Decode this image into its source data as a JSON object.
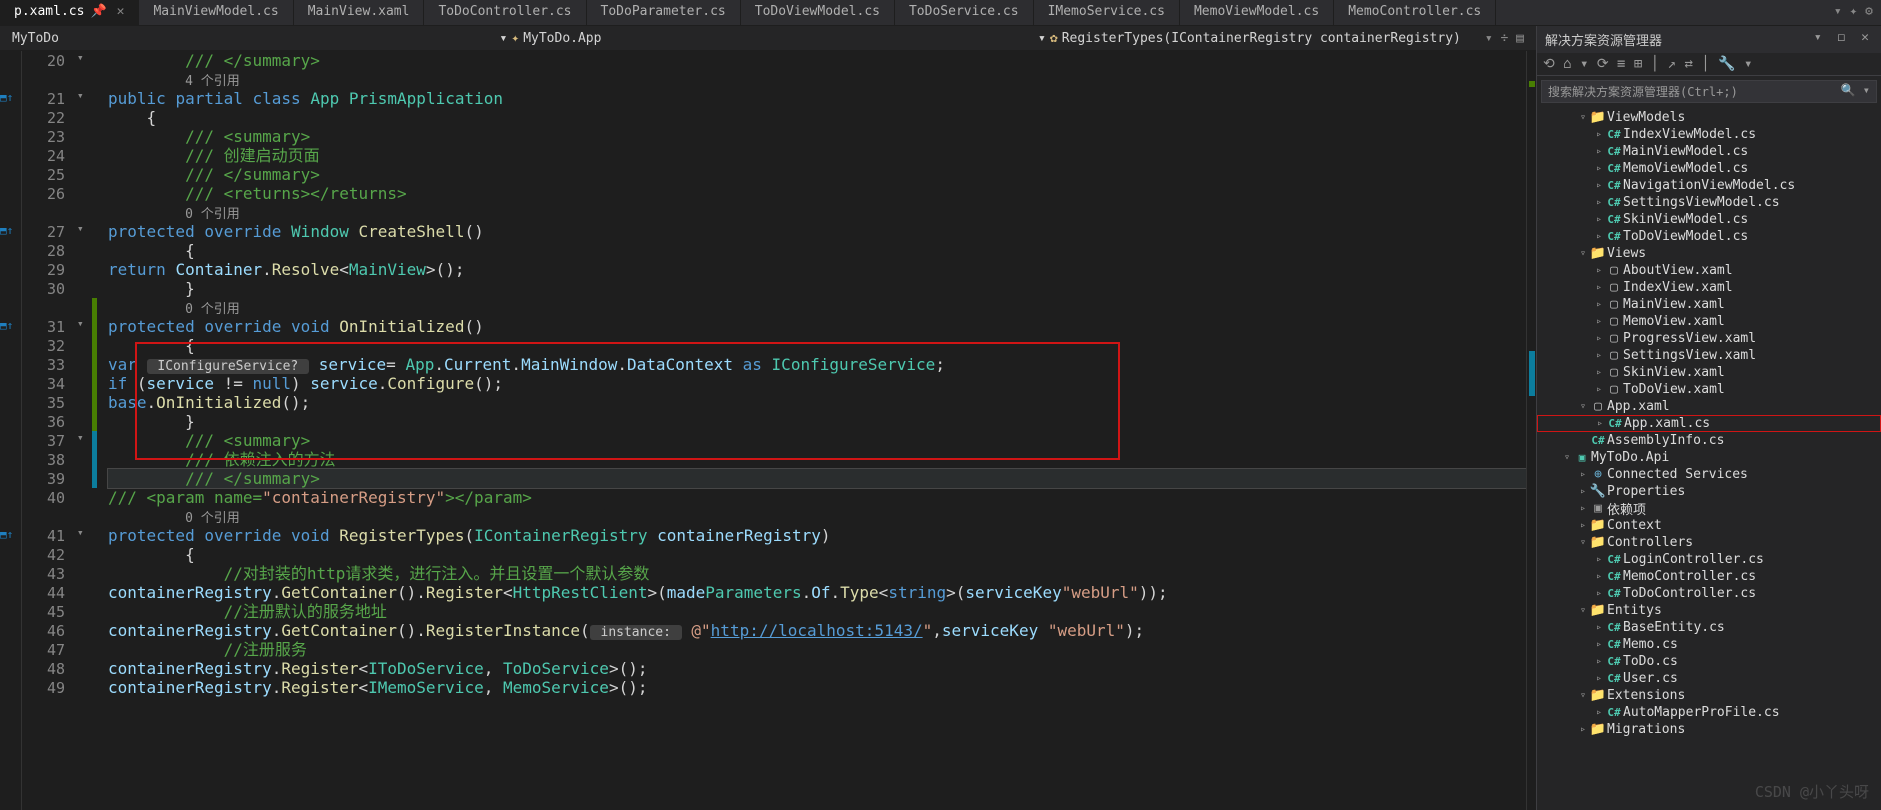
{
  "tabs": [
    {
      "label": "p.xaml.cs",
      "active": true,
      "pinned": true
    },
    {
      "label": "MainViewModel.cs"
    },
    {
      "label": "MainView.xaml"
    },
    {
      "label": "ToDoController.cs"
    },
    {
      "label": "ToDoParameter.cs"
    },
    {
      "label": "ToDoViewModel.cs"
    },
    {
      "label": "ToDoService.cs"
    },
    {
      "label": "IMemoService.cs"
    },
    {
      "label": "MemoViewModel.cs"
    },
    {
      "label": "MemoController.cs"
    }
  ],
  "context": {
    "project": "MyToDo",
    "namespace": "MyToDo.App",
    "method": "RegisterTypes(IContainerRegistry containerRegistry)"
  },
  "gutter_start": 20,
  "code_lines": [
    {
      "n": 20,
      "t": "        /// </summary>",
      "cls": "cmt",
      "fold": "▾"
    },
    {
      "n": "",
      "t": "        4 个引用",
      "cls": "ref"
    },
    {
      "n": 21,
      "t": "    public partial class App : PrismApplication",
      "tok": [
        "kw:public",
        " ",
        "kw:partial",
        " ",
        "kw:class",
        " ",
        "type:App",
        " : ",
        "type:PrismApplication"
      ],
      "fold": "▾",
      "gi": true
    },
    {
      "n": 22,
      "t": "    {"
    },
    {
      "n": 23,
      "t": "        /// <summary>",
      "cls": "cmt"
    },
    {
      "n": 24,
      "t": "        /// 创建启动页面",
      "cls": "cmt"
    },
    {
      "n": 25,
      "t": "        /// </summary>",
      "cls": "cmt"
    },
    {
      "n": 26,
      "t": "        /// <returns></returns>",
      "cls": "cmt"
    },
    {
      "n": "",
      "t": "        0 个引用",
      "cls": "ref"
    },
    {
      "n": 27,
      "t": "        protected override Window CreateShell()",
      "tok": [
        "kw:protected",
        " ",
        "kw:override",
        " ",
        "type:Window",
        " ",
        "fn:CreateShell",
        "()"
      ],
      "fold": "▾",
      "gi": true
    },
    {
      "n": 28,
      "t": "        {"
    },
    {
      "n": 29,
      "t": "            return Container.Resolve<MainView>();",
      "tok": [
        "kw:return",
        " ",
        "var:Container",
        ".",
        "fn:Resolve",
        "<",
        "type:MainView",
        ">();"
      ]
    },
    {
      "n": 30,
      "t": "        }"
    },
    {
      "n": "",
      "t": "        0 个引用",
      "cls": "ref",
      "chg": "g"
    },
    {
      "n": 31,
      "t": "        protected override void OnInitialized()",
      "tok": [
        "kw:protected",
        " ",
        "kw:override",
        " ",
        "kw:void",
        " ",
        "fn:OnInitialized",
        "()"
      ],
      "fold": "▾",
      "gi": true,
      "chg": "g"
    },
    {
      "n": 32,
      "t": "        {",
      "chg": "g"
    },
    {
      "n": 33,
      "t": "            var  IConfigureService?  service= App.Current.MainWindow.DataContext as IConfigureService;",
      "tok": [
        "kw:var",
        " ",
        "hint: IConfigureService? ",
        " ",
        "var:service",
        "= ",
        "type:App",
        ".",
        "var:Current",
        ".",
        "var:MainWindow",
        ".",
        "var:DataContext",
        " ",
        "kw:as",
        " ",
        "type:IConfigureService",
        ";"
      ],
      "chg": "g"
    },
    {
      "n": 34,
      "t": "            if (service != null) service.Configure();",
      "tok": [
        "kw:if",
        " (",
        "var:service",
        " != ",
        "kw:null",
        ") ",
        "var:service",
        ".",
        "fn:Configure",
        "();"
      ],
      "chg": "g"
    },
    {
      "n": 35,
      "t": "            base.OnInitialized();",
      "tok": [
        "kw:base",
        ".",
        "fn:OnInitialized",
        "();"
      ],
      "chg": "g"
    },
    {
      "n": 36,
      "t": "        }",
      "chg": "g"
    },
    {
      "n": 37,
      "t": "        /// <summary>",
      "cls": "cmt",
      "fold": "▾",
      "chg": "t"
    },
    {
      "n": 38,
      "t": "        /// 依赖注入的方法",
      "cls": "cmt",
      "chg": "t"
    },
    {
      "n": 39,
      "t": "        /// </summary>",
      "cls": "cmt",
      "cur": true,
      "chg": "t"
    },
    {
      "n": 40,
      "t": "        /// <param name=\"containerRegistry\"></param>",
      "tok": [
        "cmt:/// <param name=",
        "str:\"containerRegistry\"",
        "cmt:></param>"
      ]
    },
    {
      "n": "",
      "t": "        0 个引用",
      "cls": "ref"
    },
    {
      "n": 41,
      "t": "        protected override void RegisterTypes(IContainerRegistry containerRegistry)",
      "tok": [
        "kw:protected",
        " ",
        "kw:override",
        " ",
        "kw:void",
        " ",
        "fn:RegisterTypes",
        "(",
        "type:IContainerRegistry",
        " ",
        "var:containerRegistry",
        ")"
      ],
      "fold": "▾",
      "gi": true
    },
    {
      "n": 42,
      "t": "        {"
    },
    {
      "n": 43,
      "t": "            //对封装的http请求类，进行注入。并且设置一个默认参数",
      "cls": "cmt"
    },
    {
      "n": 44,
      "t": "            containerRegistry.GetContainer().Register<HttpRestClient>(made:Parameters.Of.Type<string>(serviceKey:\"webUrl\"));",
      "tok": [
        "var:containerRegistry",
        ".",
        "fn:GetContainer",
        "().",
        "fn:Register",
        "<",
        "type:HttpRestClient",
        ">(",
        "var:made",
        ":",
        "type:Parameters",
        ".",
        "var:Of",
        ".",
        "fn:Type",
        "<",
        "kw:string",
        ">(",
        "var:serviceKey",
        ":",
        "str:\"webUrl\"",
        "));"
      ]
    },
    {
      "n": 45,
      "t": "            //注册默认的服务地址",
      "cls": "cmt"
    },
    {
      "n": 46,
      "t": "            containerRegistry.GetContainer().RegisterInstance( instance:  @\"http://localhost:5143/\",serviceKey: \"webUrl\");",
      "tok": [
        "var:containerRegistry",
        ".",
        "fn:GetContainer",
        "().",
        "fn:RegisterInstance",
        "(",
        "hint: instance: ",
        " ",
        "str:@\"",
        "url:http://localhost:5143/",
        "str:\"",
        ",",
        "var:serviceKey",
        ": ",
        "str:\"webUrl\"",
        ");"
      ]
    },
    {
      "n": 47,
      "t": "            //注册服务",
      "cls": "cmt"
    },
    {
      "n": 48,
      "t": "            containerRegistry.Register<IToDoService, ToDoService>();",
      "tok": [
        "var:containerRegistry",
        ".",
        "fn:Register",
        "<",
        "type:IToDoService",
        ", ",
        "type:ToDoService",
        ">();"
      ]
    },
    {
      "n": 49,
      "t": "            containerRegistry.Register<IMemoService, MemoService>();",
      "tok": [
        "var:containerRegistry",
        ".",
        "fn:Register",
        "<",
        "type:IMemoService",
        ", ",
        "type:MemoService",
        ">();"
      ]
    }
  ],
  "sidebar": {
    "title": "解决方案资源管理器",
    "search_placeholder": "搜索解决方案资源管理器(Ctrl+;)",
    "tree": [
      {
        "d": 2,
        "e": "▿",
        "ic": "fld",
        "t": "ViewModels"
      },
      {
        "d": 3,
        "e": "▹",
        "ic": "cs",
        "t": "IndexViewModel.cs"
      },
      {
        "d": 3,
        "e": "▹",
        "ic": "cs",
        "t": "MainViewModel.cs"
      },
      {
        "d": 3,
        "e": "▹",
        "ic": "cs",
        "t": "MemoViewModel.cs"
      },
      {
        "d": 3,
        "e": "▹",
        "ic": "cs",
        "t": "NavigationViewModel.cs"
      },
      {
        "d": 3,
        "e": "▹",
        "ic": "cs",
        "t": "SettingsViewModel.cs"
      },
      {
        "d": 3,
        "e": "▹",
        "ic": "cs",
        "t": "SkinViewModel.cs"
      },
      {
        "d": 3,
        "e": "▹",
        "ic": "cs",
        "t": "ToDoViewModel.cs"
      },
      {
        "d": 2,
        "e": "▿",
        "ic": "fld",
        "t": "Views"
      },
      {
        "d": 3,
        "e": "▹",
        "ic": "xaml",
        "t": "AboutView.xaml"
      },
      {
        "d": 3,
        "e": "▹",
        "ic": "xaml",
        "t": "IndexView.xaml"
      },
      {
        "d": 3,
        "e": "▹",
        "ic": "xaml",
        "t": "MainView.xaml"
      },
      {
        "d": 3,
        "e": "▹",
        "ic": "xaml",
        "t": "MemoView.xaml"
      },
      {
        "d": 3,
        "e": "▹",
        "ic": "xaml",
        "t": "ProgressView.xaml"
      },
      {
        "d": 3,
        "e": "▹",
        "ic": "xaml",
        "t": "SettingsView.xaml"
      },
      {
        "d": 3,
        "e": "▹",
        "ic": "xaml",
        "t": "SkinView.xaml"
      },
      {
        "d": 3,
        "e": "▹",
        "ic": "xaml",
        "t": "ToDoView.xaml"
      },
      {
        "d": 2,
        "e": "▿",
        "ic": "xaml",
        "t": "App.xaml"
      },
      {
        "d": 3,
        "e": "▹",
        "ic": "cs",
        "t": "App.xaml.cs",
        "sel": true
      },
      {
        "d": 2,
        "e": "",
        "ic": "cs",
        "t": "AssemblyInfo.cs"
      },
      {
        "d": 1,
        "e": "▿",
        "ic": "proj",
        "t": "MyToDo.Api"
      },
      {
        "d": 2,
        "e": "▹",
        "ic": "svc",
        "t": "Connected Services"
      },
      {
        "d": 2,
        "e": "▹",
        "ic": "wrench",
        "t": "Properties"
      },
      {
        "d": 2,
        "e": "▹",
        "ic": "dep",
        "t": "依赖项"
      },
      {
        "d": 2,
        "e": "▹",
        "ic": "fld",
        "t": "Context"
      },
      {
        "d": 2,
        "e": "▿",
        "ic": "fld",
        "t": "Controllers"
      },
      {
        "d": 3,
        "e": "▹",
        "ic": "cs",
        "t": "LoginController.cs"
      },
      {
        "d": 3,
        "e": "▹",
        "ic": "cs",
        "t": "MemoController.cs"
      },
      {
        "d": 3,
        "e": "▹",
        "ic": "cs",
        "t": "ToDoController.cs"
      },
      {
        "d": 2,
        "e": "▿",
        "ic": "fld",
        "t": "Entitys"
      },
      {
        "d": 3,
        "e": "▹",
        "ic": "cs",
        "t": "BaseEntity.cs"
      },
      {
        "d": 3,
        "e": "▹",
        "ic": "cs",
        "t": "Memo.cs"
      },
      {
        "d": 3,
        "e": "▹",
        "ic": "cs",
        "t": "ToDo.cs"
      },
      {
        "d": 3,
        "e": "▹",
        "ic": "cs",
        "t": "User.cs"
      },
      {
        "d": 2,
        "e": "▿",
        "ic": "fld",
        "t": "Extensions"
      },
      {
        "d": 3,
        "e": "▹",
        "ic": "cs",
        "t": "AutoMapperProFile.cs"
      },
      {
        "d": 2,
        "e": "▹",
        "ic": "fld",
        "t": "Migrations"
      }
    ]
  },
  "watermark": "CSDN @小丫头呀"
}
